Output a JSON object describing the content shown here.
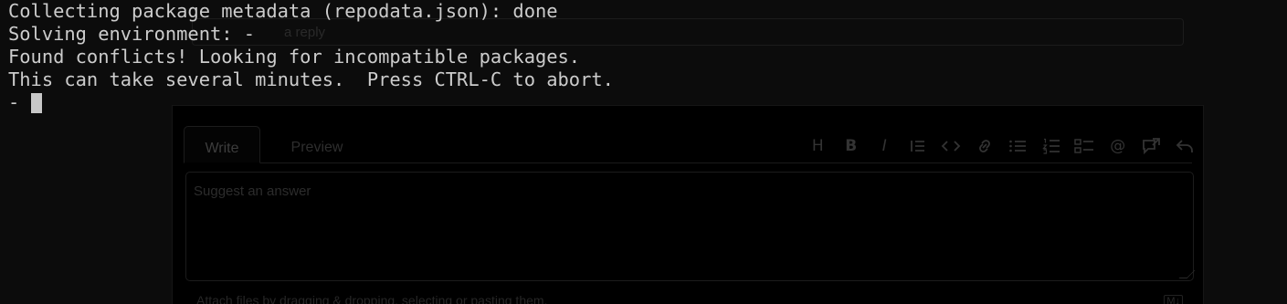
{
  "terminal": {
    "lines": [
      "Collecting package metadata (repodata.json): done",
      "Solving environment: -",
      "Found conflicts! Looking for incompatible packages.",
      "This can take several minutes.  Press CTRL-C to abort."
    ],
    "spinner": "-",
    "text_color": "#cccccc",
    "background_color": "#0c0c0c"
  },
  "background_page": {
    "reply_placeholder": "a reply",
    "tabs": {
      "write": "Write",
      "preview": "Preview"
    },
    "toolbar_icons": [
      "heading-icon",
      "bold-icon",
      "italic-icon",
      "quote-icon",
      "code-icon",
      "link-icon",
      "bulleted-list-icon",
      "numbered-list-icon",
      "task-list-icon",
      "mention-icon",
      "reference-icon",
      "undo-icon"
    ],
    "textarea_placeholder": "Suggest an answer",
    "attach_hint": "Attach files by dragging & dropping, selecting or pasting them.",
    "markdown_badge": "M↓"
  }
}
